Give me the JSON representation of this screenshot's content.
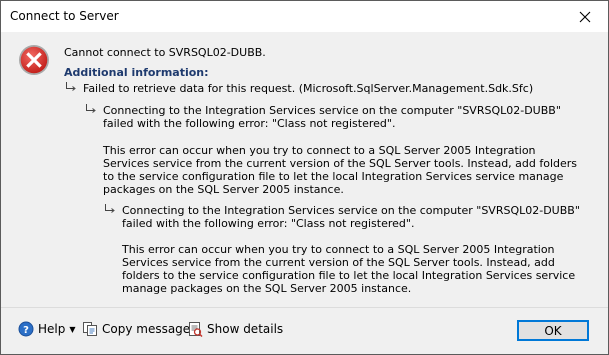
{
  "window": {
    "title": "Connect to Server"
  },
  "message": {
    "main": "Cannot connect to SVRSQL02-DUBB.",
    "additional_heading": "Additional information:"
  },
  "details": [
    {
      "level": 1,
      "text": "Failed to retrieve data for this request. (Microsoft.SqlServer.Management.Sdk.Sfc)"
    },
    {
      "level": 2,
      "text": "Connecting to the Integration Services service on the computer \"SVRSQL02-DUBB\" failed with the following error: \"Class not registered\"."
    },
    {
      "level": 2,
      "text": "This error can occur when you try to connect to a SQL Server 2005 Integration Services service from the current version of the SQL Server tools. Instead, add folders to the service configuration file to let the local Integration Services service manage packages on the SQL Server 2005 instance."
    },
    {
      "level": 3,
      "text": "Connecting to the Integration Services service on the computer \"SVRSQL02-DUBB\" failed with the following error: \"Class not registered\"."
    },
    {
      "level": 3,
      "text": "This error can occur when you try to connect to a SQL Server 2005 Integration Services service from the current version of the SQL Server tools. Instead, add folders to the service configuration file to let the local Integration Services service manage packages on the SQL Server 2005 instance."
    }
  ],
  "footer": {
    "help_label": "Help",
    "copy_label": "Copy message",
    "details_label": "Show details",
    "ok_label": "OK"
  },
  "icons": {
    "error": "error-icon",
    "close": "close-icon",
    "help": "help-icon",
    "copy": "copy-icon",
    "details": "show-details-icon",
    "arrow": "child-arrow-icon"
  },
  "colors": {
    "error_red": "#d9302b",
    "heading_blue": "#1e3a6e",
    "ok_border": "#0078d7"
  }
}
